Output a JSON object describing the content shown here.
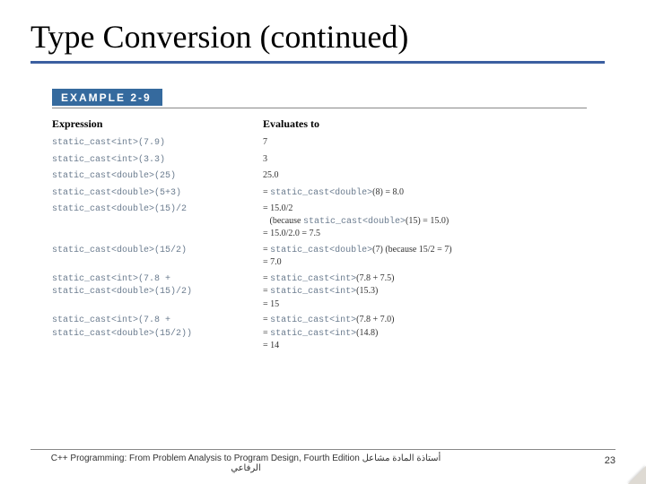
{
  "title": "Type Conversion (continued)",
  "example_label": "EXAMPLE 2-9",
  "headers": {
    "left": "Expression",
    "right": "Evaluates to"
  },
  "rows": [
    {
      "l": "static_cast<int>(7.9)",
      "r_plain": "7"
    },
    {
      "l": "static_cast<int>(3.3)",
      "r_plain": "3"
    },
    {
      "l": "static_cast<double>(25)",
      "r_plain": "25.0"
    },
    {
      "l": "static_cast<double>(5+3)",
      "r_lines": [
        {
          "pre": "= ",
          "code": "static_cast<double>",
          "post": "(8) = 8.0"
        }
      ]
    },
    {
      "l": "static_cast<double>(15)/2",
      "r_lines": [
        {
          "pre": "= 15.0/2",
          "code": "",
          "post": ""
        },
        {
          "pre": "   (because ",
          "code": "static_cast<double>",
          "post": "(15) = 15.0)"
        },
        {
          "pre": "= 15.0/2.0 = 7.5",
          "code": "",
          "post": ""
        }
      ]
    },
    {
      "l": "static_cast<double>(15/2)",
      "r_lines": [
        {
          "pre": "= ",
          "code": "static_cast<double>",
          "post": "(7) (because 15/2 = 7)"
        },
        {
          "pre": "= 7.0",
          "code": "",
          "post": ""
        }
      ]
    },
    {
      "l_lines": [
        "static_cast<int>(7.8 +",
        "static_cast<double>(15)/2)"
      ],
      "r_lines": [
        {
          "pre": "= ",
          "code": "static_cast<int>",
          "post": "(7.8 + 7.5)"
        },
        {
          "pre": "= ",
          "code": "static_cast<int>",
          "post": "(15.3)"
        },
        {
          "pre": "= 15",
          "code": "",
          "post": ""
        }
      ]
    },
    {
      "l_lines": [
        "static_cast<int>(7.8 +",
        "static_cast<double>(15/2))"
      ],
      "r_lines": [
        {
          "pre": "= ",
          "code": "static_cast<int>",
          "post": "(7.8 + 7.0)"
        },
        {
          "pre": "= ",
          "code": "static_cast<int>",
          "post": "(14.8)"
        },
        {
          "pre": "= 14",
          "code": "",
          "post": ""
        }
      ]
    }
  ],
  "footer": {
    "text_line1": "C++ Programming: From Problem Analysis to Program Design, Fourth Edition أستاذة المادة مشاعل",
    "text_line2": "الرفاعي",
    "page": "23"
  }
}
